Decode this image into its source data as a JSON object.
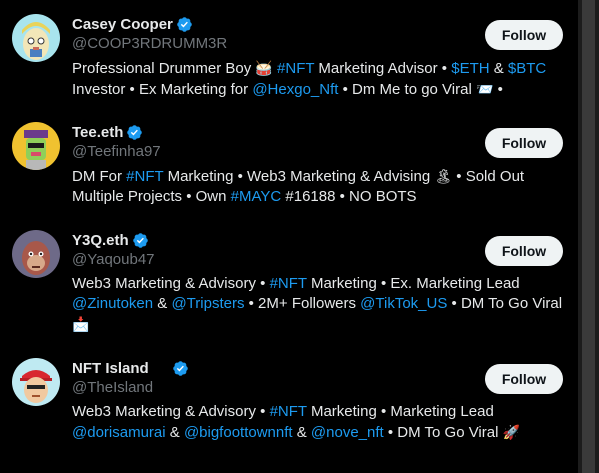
{
  "who_to_follow": {
    "follow_label": "Follow",
    "users": [
      {
        "display_name": "Casey Cooper",
        "handle": "@COOP3RDRUMM3R",
        "bio": [
          {
            "t": "Professional Drummer Boy "
          },
          {
            "t": "🥁",
            "emoji": true
          },
          {
            "t": " "
          },
          {
            "t": "#NFT",
            "link": true
          },
          {
            "t": " Marketing Advisor • "
          },
          {
            "t": "$ETH",
            "link": true
          },
          {
            "t": " & "
          },
          {
            "t": "$BTC",
            "link": true
          },
          {
            "t": " Investor • Ex Marketing for "
          },
          {
            "t": "@Hexgo_Nft",
            "link": true
          },
          {
            "t": " • Dm Me to go Viral "
          },
          {
            "t": "📨",
            "emoji": true
          },
          {
            "t": " •"
          }
        ]
      },
      {
        "display_name": "Tee.eth",
        "handle": "@Teefinha97",
        "bio": [
          {
            "t": "DM For "
          },
          {
            "t": "#NFT",
            "link": true
          },
          {
            "t": " Marketing • Web3 Marketing & Advising "
          },
          {
            "t": "🏝",
            "emoji": true
          },
          {
            "t": " • Sold Out Multiple Projects • Own "
          },
          {
            "t": "#MAYC",
            "link": true
          },
          {
            "t": " #16188 • NO BOTS"
          }
        ]
      },
      {
        "display_name": "Y3Q.eth",
        "handle": "@Yaqoub47",
        "bio": [
          {
            "t": "Web3 Marketing & Advisory • "
          },
          {
            "t": "#NFT",
            "link": true
          },
          {
            "t": " Marketing • Ex. Marketing Lead "
          },
          {
            "t": "@Zinutoken",
            "link": true
          },
          {
            "t": " & "
          },
          {
            "t": "@Tripsters",
            "link": true
          },
          {
            "t": " • 2M+ Followers "
          },
          {
            "t": "@TikTok_US",
            "link": true
          },
          {
            "t": " • DM To Go Viral "
          },
          {
            "t": "📩",
            "emoji": true
          }
        ]
      },
      {
        "display_name": "NFT Island",
        "name_emoji": "🏝",
        "handle": "@TheIsland",
        "bio": [
          {
            "t": "Web3 Marketing & Advisory • "
          },
          {
            "t": "#NFT",
            "link": true
          },
          {
            "t": " Marketing • Marketing Lead "
          },
          {
            "t": "@dorisamurai",
            "link": true
          },
          {
            "t": " & "
          },
          {
            "t": "@bigfoottownnft",
            "link": true
          },
          {
            "t": " & "
          },
          {
            "t": "@nove_nft",
            "link": true
          },
          {
            "t": " • DM To Go Viral "
          },
          {
            "t": "🚀",
            "emoji": true
          }
        ]
      }
    ]
  },
  "colors": {
    "background": "#000000",
    "primary_text": "#e7e9ea",
    "secondary_text": "#71767b",
    "link": "#1d9bf0",
    "verified_badge": "#1d9bf0",
    "follow_button_bg": "#eff3f4",
    "follow_button_text": "#0f1419"
  },
  "icons": {
    "verified": "verified-badge-icon"
  }
}
